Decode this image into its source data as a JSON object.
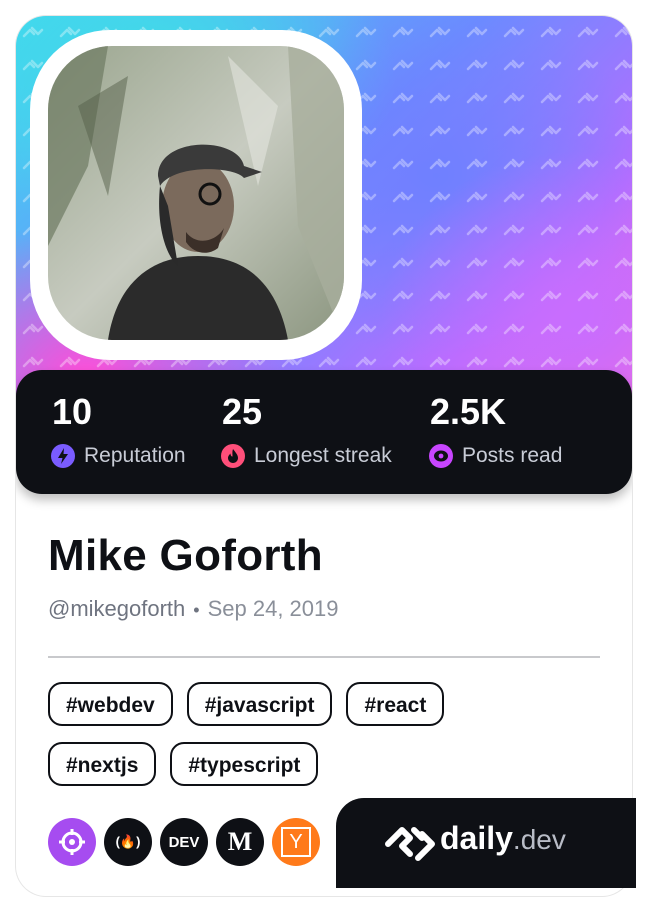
{
  "stats": {
    "reputation": {
      "value": "10",
      "label": "Reputation"
    },
    "streak": {
      "value": "25",
      "label": "Longest streak"
    },
    "posts": {
      "value": "2.5K",
      "label": "Posts read"
    }
  },
  "profile": {
    "name": "Mike Goforth",
    "handle": "@mikegoforth",
    "separator": "•",
    "joined": "Sep 24, 2019"
  },
  "tags": [
    "#webdev",
    "#javascript",
    "#react",
    "#nextjs",
    "#typescript"
  ],
  "sources": [
    {
      "name": "crosshair",
      "color": "#a64cf0",
      "glyph": ""
    },
    {
      "name": "fcc",
      "color": "#0e1015",
      "glyph": "(🔥)"
    },
    {
      "name": "dev",
      "color": "#0e1015",
      "glyph": "DEV"
    },
    {
      "name": "medium",
      "color": "#0e1015",
      "glyph": "M"
    },
    {
      "name": "hackernews",
      "color": "#ff7a1a",
      "glyph": "Y"
    }
  ],
  "brand": {
    "main": "daily",
    "suffix": ".dev"
  },
  "colors": {
    "reputation_icon": "#7a5cff",
    "streak_icon": "#ff4f7a",
    "posts_icon": "#c845ff",
    "dark": "#0e1015"
  }
}
